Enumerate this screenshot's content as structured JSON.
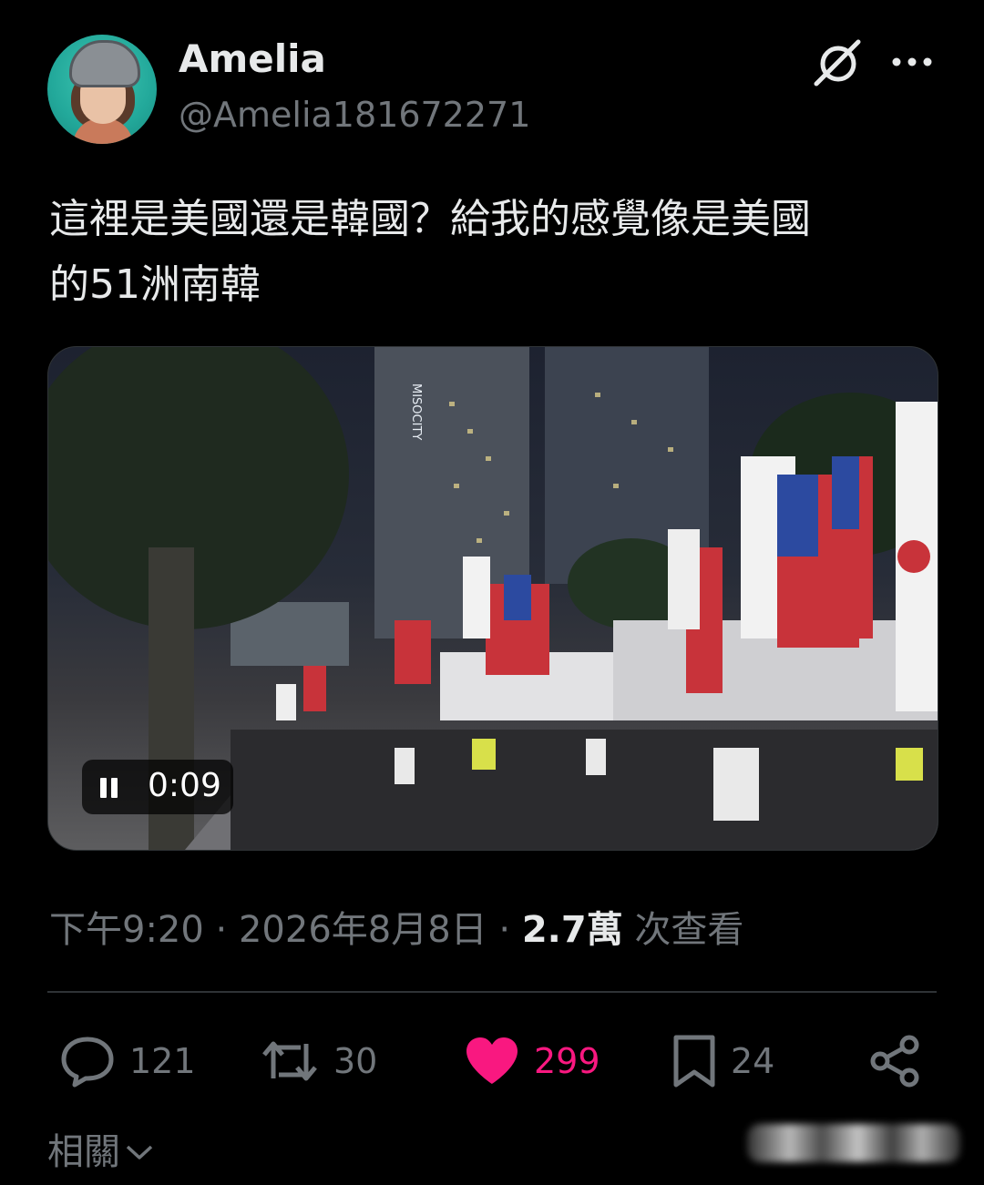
{
  "author": {
    "name": "Amelia",
    "handle": "@Amelia181672271"
  },
  "post": {
    "text_line1": "這裡是美國還是韓國？給我的感覺像是美國",
    "text_line2": "的51洲南韓",
    "video": {
      "elapsed": "0:09",
      "state": "playing",
      "building_sign": "MISOCITY"
    },
    "meta": {
      "time": "下午9:20",
      "date": "2026年8月8日",
      "views": "2.7萬",
      "views_label": "次查看"
    }
  },
  "actions": {
    "replies": "121",
    "reposts": "30",
    "likes": "299",
    "bookmarks": "24"
  },
  "footer": {
    "related_label": "相關"
  },
  "icons": [
    "grok-icon",
    "more-icon",
    "pause-icon",
    "reply-icon",
    "repost-icon",
    "like-icon",
    "bookmark-icon",
    "share-icon",
    "chevron-down-icon"
  ],
  "colors": {
    "background": "#000000",
    "text": "#e7e9ea",
    "secondary": "#71767b",
    "like": "#f91880",
    "divider": "#2f3336"
  }
}
